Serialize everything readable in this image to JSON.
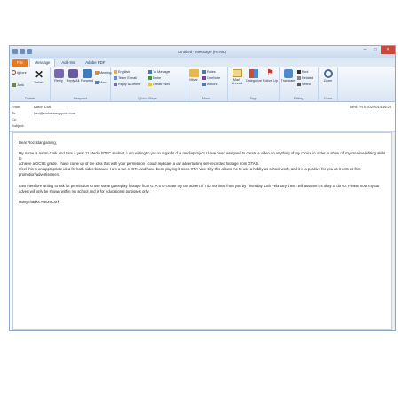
{
  "window": {
    "title": "Untitled - Message (HTML)"
  },
  "tabs": [
    {
      "label": "File"
    },
    {
      "label": "Message"
    },
    {
      "label": "Add-Ins"
    },
    {
      "label": "Adobe PDF"
    }
  ],
  "ribbon": {
    "delete_group": {
      "ignore": "Ignore",
      "junk": "Junk",
      "delete": "Delete",
      "label": "Delete"
    },
    "respond_group": {
      "reply": "Reply",
      "reply_all": "Reply All",
      "forward": "Forward",
      "meeting": "Meeting",
      "more": "More",
      "label": "Respond"
    },
    "quicksteps_group": {
      "items": [
        "Engllish",
        "To Manager",
        "Team E-mail",
        "Done",
        "Reply & Delete",
        "Create New"
      ],
      "label": "Quick Steps"
    },
    "move_group": {
      "move": "Move",
      "rules": "Rules",
      "onenote": "OneNote",
      "actions": "Actions",
      "label": "Move"
    },
    "tags_group": {
      "unread": "Mark Unread",
      "categorize": "Categorize",
      "follow_up": "Follow Up",
      "label": "Tags"
    },
    "editing_group": {
      "translate": "Translate",
      "find": "Find",
      "related": "Related",
      "select": "Select",
      "label": "Editing"
    },
    "zoom_group": {
      "zoom": "Zoom",
      "label": "Zoom"
    }
  },
  "headers": {
    "from_label": "From:",
    "from_value": "Aaron Cork",
    "to_label": "To:",
    "to_value": "Leo@rockstarsupport.com",
    "cc_label": "Cc:",
    "subject_label": "Subject:",
    "sent": "Sent:   Fri 07/02/2014 16:25"
  },
  "body": {
    "greeting": "Dear Rockstar gaming,",
    "p1_lines": [
      "My name is Aaron Cork and I am a year 11 Media BTEC student, I am writing to you in regards of a media project I have been assigned to create a video on anything of my choice in order to show off my creative/editing skills to",
      "achieve a GCSE grade. I have come up of the idea that with your permission I could replicate a car advert using self-recorded footage from GTA 5.",
      "I feel this is an appropriate idea for both sides because I am a fan of GTA and have been playing it since GTA Vice City this allows me to use a hobby as school work, and it is a positive for you as it acts as free",
      "promotion/advertisement."
    ],
    "p2_lines": [
      "I am therefore writing to ask for permission to use some gameplay footage from GTA 5 to create my car advert. If I do not hear from you by Thursday 13th February then I will assume it's okay to do so. Please note my car",
      "advert will only be shown within my school and is for educational purposes only."
    ],
    "signoff": "Many thanks Aaron Cork"
  }
}
